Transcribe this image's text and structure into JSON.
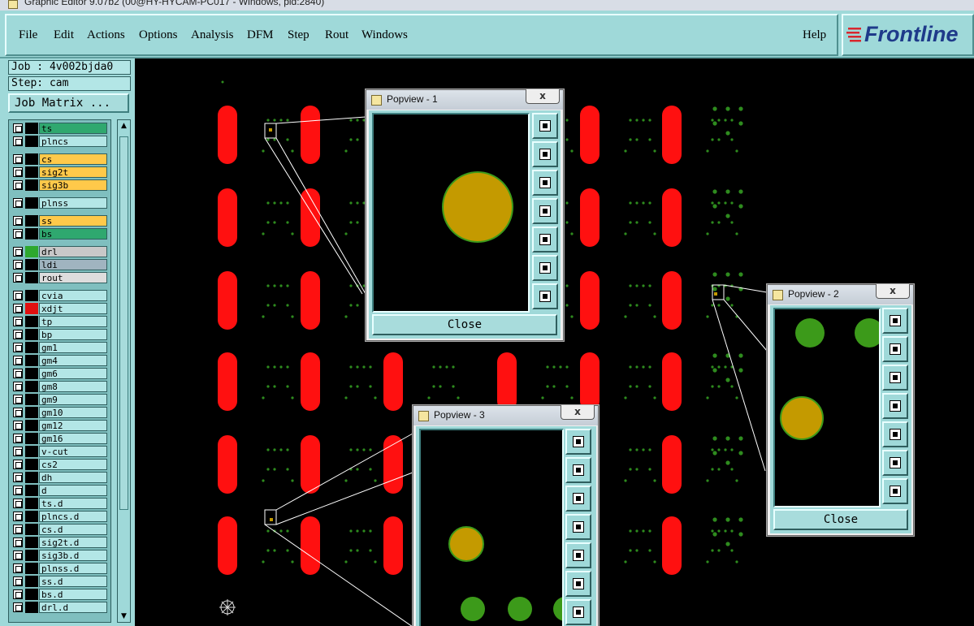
{
  "window": {
    "title": "Graphic Editor 9.07b2 (00@HY-HYCAM-PC017 - Windows, pid:2840)"
  },
  "menu": {
    "items": [
      "File",
      "Edit",
      "Actions",
      "Options",
      "Analysis",
      "DFM",
      "Step",
      "Rout",
      "Windows"
    ],
    "help": "Help"
  },
  "logo": {
    "text": "Frontline"
  },
  "job": {
    "job_label": "Job : 4v002bjda0",
    "step_label": "Step: cam",
    "matrix_button": "Job Matrix ..."
  },
  "layers": [
    {
      "name": "ts",
      "bg": "#2fa86f",
      "swatch": "#000000"
    },
    {
      "name": "plncs",
      "bg": "#b3e6e6",
      "swatch": "#000000"
    },
    {
      "name": "cs",
      "bg": "#ffc94a",
      "swatch": "#000000"
    },
    {
      "name": "sig2t",
      "bg": "#ffc94a",
      "swatch": "#000000"
    },
    {
      "name": "sig3b",
      "bg": "#ffc94a",
      "swatch": "#000000"
    },
    {
      "name": "plnss",
      "bg": "#b3e6e6",
      "swatch": "#000000"
    },
    {
      "name": "ss",
      "bg": "#ffc94a",
      "swatch": "#000000"
    },
    {
      "name": "bs",
      "bg": "#2fa86f",
      "swatch": "#000000"
    },
    {
      "name": "drl",
      "bg": "#c8c8c8",
      "swatch": "#2ea82e"
    },
    {
      "name": "ldi",
      "bg": "#a0b4c0",
      "swatch": "#000000"
    },
    {
      "name": "rout",
      "bg": "#dddddd",
      "swatch": "#000000"
    },
    {
      "name": "cvia",
      "bg": "#b3e6e6",
      "swatch": "#000000"
    },
    {
      "name": "xdjt",
      "bg": "#b3e6e6",
      "swatch": "#e01010"
    },
    {
      "name": "tp",
      "bg": "#b3e6e6",
      "swatch": "#000000"
    },
    {
      "name": "bp",
      "bg": "#b3e6e6",
      "swatch": "#000000"
    },
    {
      "name": "gm1",
      "bg": "#b3e6e6",
      "swatch": "#000000"
    },
    {
      "name": "gm4",
      "bg": "#b3e6e6",
      "swatch": "#000000"
    },
    {
      "name": "gm6",
      "bg": "#b3e6e6",
      "swatch": "#000000"
    },
    {
      "name": "gm8",
      "bg": "#b3e6e6",
      "swatch": "#000000"
    },
    {
      "name": "gm9",
      "bg": "#b3e6e6",
      "swatch": "#000000"
    },
    {
      "name": "gm10",
      "bg": "#b3e6e6",
      "swatch": "#000000"
    },
    {
      "name": "gm12",
      "bg": "#b3e6e6",
      "swatch": "#000000"
    },
    {
      "name": "gm16",
      "bg": "#b3e6e6",
      "swatch": "#000000"
    },
    {
      "name": "v-cut",
      "bg": "#b3e6e6",
      "swatch": "#000000"
    },
    {
      "name": "cs2",
      "bg": "#b3e6e6",
      "swatch": "#000000"
    },
    {
      "name": "dh",
      "bg": "#b3e6e6",
      "swatch": "#000000"
    },
    {
      "name": "d",
      "bg": "#b3e6e6",
      "swatch": "#000000"
    },
    {
      "name": "ts.d",
      "bg": "#b3e6e6",
      "swatch": "#000000"
    },
    {
      "name": "plncs.d",
      "bg": "#b3e6e6",
      "swatch": "#000000"
    },
    {
      "name": "cs.d",
      "bg": "#b3e6e6",
      "swatch": "#000000"
    },
    {
      "name": "sig2t.d",
      "bg": "#b3e6e6",
      "swatch": "#000000"
    },
    {
      "name": "sig3b.d",
      "bg": "#b3e6e6",
      "swatch": "#000000"
    },
    {
      "name": "plnss.d",
      "bg": "#b3e6e6",
      "swatch": "#000000"
    },
    {
      "name": "ss.d",
      "bg": "#b3e6e6",
      "swatch": "#000000"
    },
    {
      "name": "bs.d",
      "bg": "#b3e6e6",
      "swatch": "#000000"
    },
    {
      "name": "drl.d",
      "bg": "#b3e6e6",
      "swatch": "#000000"
    }
  ],
  "popviews": [
    {
      "title": "Popview - 1",
      "close_label": "Close",
      "close_x": "x"
    },
    {
      "title": "Popview - 2",
      "close_label": "Close",
      "close_x": "x"
    },
    {
      "title": "Popview - 3",
      "close_label": "Close",
      "close_x": "x"
    }
  ],
  "colors": {
    "pad": "#ff1010",
    "drill": "#2e8b1e",
    "gold": "#c49a00",
    "panel": "#9fd9d9"
  },
  "icons": {
    "popview_tools": [
      "zoom-fit-icon",
      "pan-up-icon",
      "pan-down-icon",
      "pan-left-icon",
      "pan-right-icon",
      "zoom-out-icon",
      "zoom-in-icon"
    ]
  }
}
